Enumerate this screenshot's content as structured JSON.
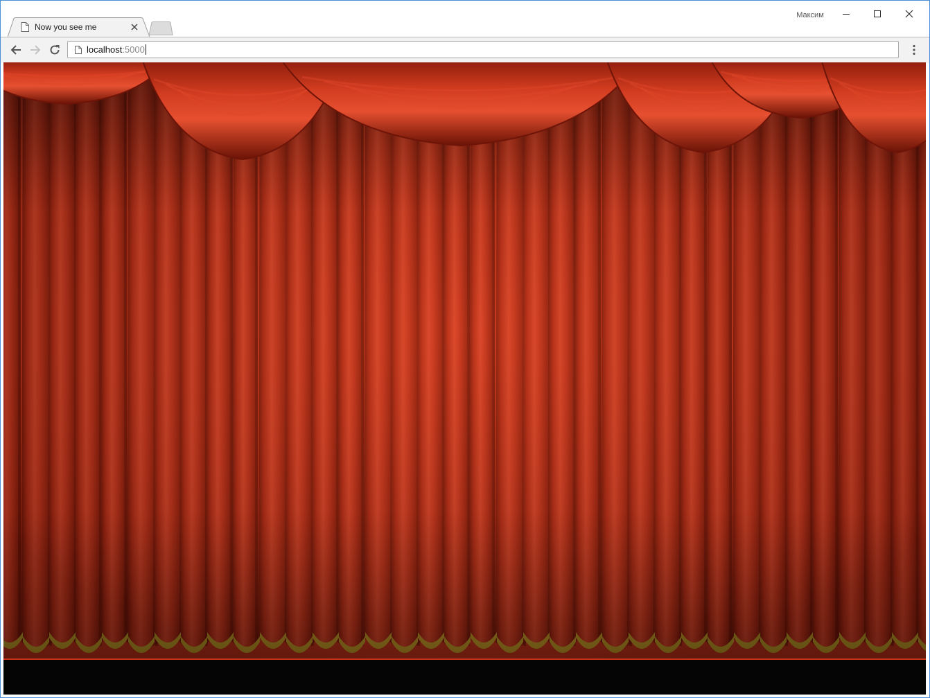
{
  "browser": {
    "tab": {
      "title": "Now you see me",
      "icon": "page-icon",
      "close_icon": "close-icon"
    },
    "new_tab_icon": "new-tab-icon",
    "profile": {
      "name": "Максим"
    },
    "window_controls": {
      "minimize_icon": "minimize-icon",
      "maximize_icon": "maximize-icon",
      "close_icon": "close-icon"
    },
    "toolbar": {
      "back_icon": "arrow-left-icon",
      "forward_icon": "arrow-right-icon",
      "reload_icon": "reload-icon",
      "menu_icon": "kebab-menu-icon"
    },
    "omnibox": {
      "host": "localhost",
      "port": ":5000",
      "icon": "page-icon"
    }
  },
  "page": {
    "scene": "red-theater-curtain",
    "colors": {
      "curtain": "#c8321a",
      "curtain_highlight": "#e0462a",
      "curtain_shadow": "#6e1408",
      "fringe": "#c9a227",
      "floor": "#050505",
      "window_border": "#4a8fd4"
    }
  }
}
